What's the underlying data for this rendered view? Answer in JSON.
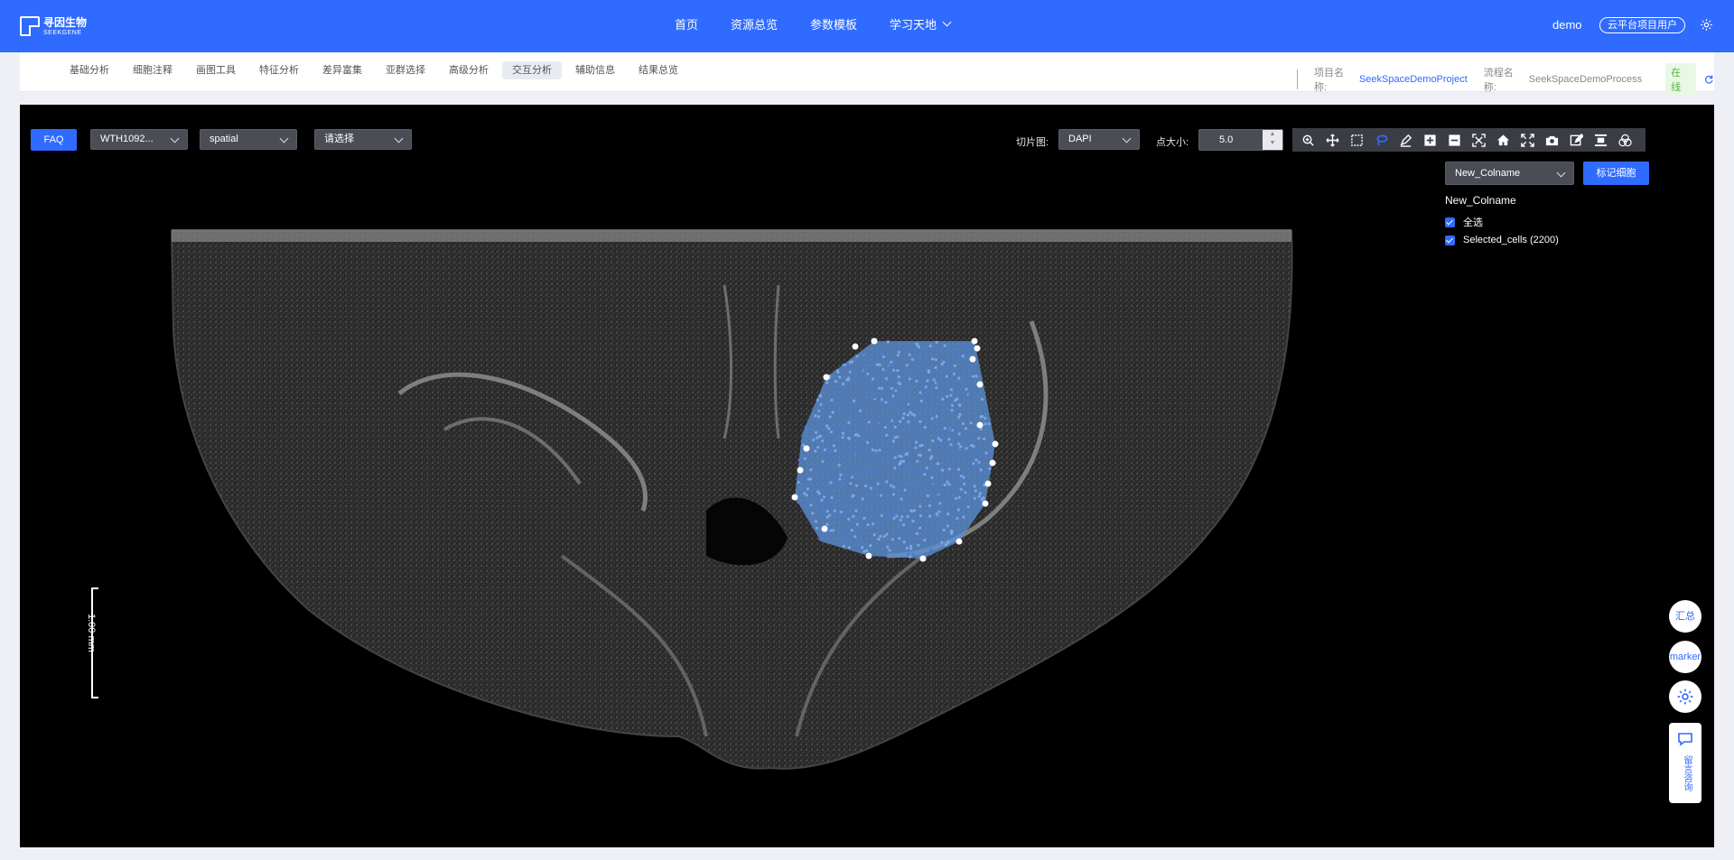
{
  "topbar": {
    "logo_cn": "寻因生物",
    "logo_en": "SEEKGENE",
    "nav": [
      "首页",
      "资源总览",
      "参数模板",
      "学习天地"
    ],
    "user": "demo",
    "badge": "云平台项目用户"
  },
  "tabs": [
    "基础分析",
    "细胞注释",
    "画图工具",
    "特征分析",
    "差异富集",
    "亚群选择",
    "高级分析",
    "交互分析",
    "辅助信息",
    "结果总览"
  ],
  "active_tab": "交互分析",
  "project": {
    "project_label": "项目名称:",
    "project_value": "SeekSpaceDemoProject",
    "process_label": "流程名称:",
    "process_value": "SeekSpaceDemoProcess",
    "status": "在线"
  },
  "viewer": {
    "faq": "FAQ",
    "sample_select": "WTH1092...",
    "embedding_select": "spatial",
    "group_select": "请选择",
    "slice_label": "切片图:",
    "slice_select": "DAPI",
    "point_size_label": "点大小:",
    "point_size": "5.0",
    "colname_select": "New_Colname",
    "mark_button": "标记细胞",
    "legend_title": "New_Colname",
    "legend_all": "全选",
    "legend_selected": "Selected_cells (2200)",
    "scale_label": "1.00 mm"
  },
  "toolbar_icons": [
    "zoom-in-icon",
    "pan-icon",
    "box-select-icon",
    "lasso-select-icon",
    "draw-icon",
    "zoom-plus-icon",
    "zoom-minus-icon",
    "autoscale-icon",
    "home-icon",
    "fullscreen-icon",
    "camera-icon",
    "edit-icon",
    "align-icon",
    "venn-icon"
  ],
  "floaters": {
    "summary": "汇总",
    "marker": "marker",
    "contact": "留言咨询"
  },
  "colors": {
    "primary": "#2f6bff",
    "selected_cells": "#5b8fd6",
    "online": "#58b440"
  }
}
